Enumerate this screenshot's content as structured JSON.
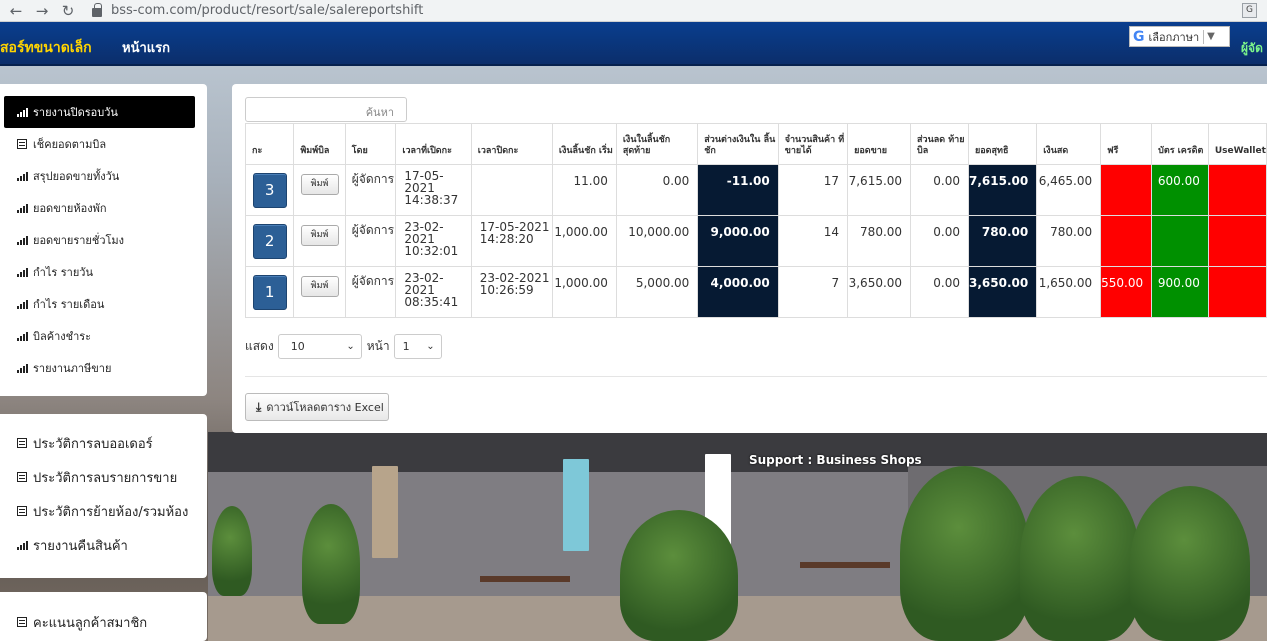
{
  "browser": {
    "url": "bss-com.com/product/resort/sale/salereportshift"
  },
  "navbar": {
    "brand": "สอร์ทขนาดเล็ก",
    "home": "หน้าแรก",
    "language_select": "เลือกภาษา",
    "user": "ผู้จัด"
  },
  "sidebar": {
    "reports": [
      {
        "label": "รายงานปิดรอบวัน",
        "icon": "bar-chart-icon",
        "active": true
      },
      {
        "label": "เช็คยอดตามบิล",
        "icon": "list-icon"
      },
      {
        "label": "สรุปยอดขายทั้งวัน",
        "icon": "bar-chart-icon"
      },
      {
        "label": "ยอดขายห้องพัก",
        "icon": "bar-chart-icon"
      },
      {
        "label": "ยอดขายรายชั่วโมง",
        "icon": "bar-chart-icon"
      },
      {
        "label": "กำไร รายวัน",
        "icon": "bar-chart-icon"
      },
      {
        "label": "กำไร รายเดือน",
        "icon": "bar-chart-icon"
      },
      {
        "label": "บิลค้างชำระ",
        "icon": "bar-chart-icon"
      },
      {
        "label": "รายงานภาษีขาย",
        "icon": "bar-chart-icon"
      }
    ],
    "history": [
      {
        "label": "ประวัติการลบออเดอร์",
        "icon": "list-icon"
      },
      {
        "label": "ประวัติการลบรายการขาย",
        "icon": "list-icon"
      },
      {
        "label": "ประวัติการย้ายห้อง/รวมห้อง",
        "icon": "list-icon"
      },
      {
        "label": "รายงานคืนสินค้า",
        "icon": "bar-chart-icon"
      }
    ],
    "members": [
      {
        "label": "คะแนนลูกค้าสมาชิก",
        "icon": "list-icon"
      }
    ]
  },
  "search": {
    "placeholder": "ค้นหา"
  },
  "table": {
    "headers": [
      "กะ",
      "พิมพ์บิล",
      "โดย",
      "เวลาที่เปิดกะ",
      "เวลาปิดกะ",
      "เงินลิ้นชัก เริ่ม",
      "เงินในลิ้นชัก สุดท้าย",
      "ส่วนต่างเงินใน ลิ้นชัก",
      "จำนวนสินค้า ที่ขายได้",
      "ยอดขาย",
      "ส่วนลด ท้ายบิล",
      "ยอดสุทธิ",
      "เงินสด",
      "ฟรี",
      "บัตร เครดิต",
      "UseWallet"
    ],
    "rows": [
      {
        "shift": "3",
        "print": "พิมพ์",
        "by": "ผู้จัดการ",
        "open": "17-05-2021 14:38:37",
        "close": "",
        "start_cash": "11.00",
        "end_cash": "0.00",
        "diff": "-11.00",
        "qty": "17",
        "sales": "7,615.00",
        "discount": "0.00",
        "net": "7,615.00",
        "cash": "6,465.00",
        "free": "",
        "credit": "600.00",
        "wallet": ""
      },
      {
        "shift": "2",
        "print": "พิมพ์",
        "by": "ผู้จัดการ",
        "open": "23-02-2021 10:32:01",
        "close": "17-05-2021 14:28:20",
        "start_cash": "1,000.00",
        "end_cash": "10,000.00",
        "diff": "9,000.00",
        "qty": "14",
        "sales": "780.00",
        "discount": "0.00",
        "net": "780.00",
        "cash": "780.00",
        "free": "",
        "credit": "",
        "wallet": ""
      },
      {
        "shift": "1",
        "print": "พิมพ์",
        "by": "ผู้จัดการ",
        "open": "23-02-2021 08:35:41",
        "close": "23-02-2021 10:26:59",
        "start_cash": "1,000.00",
        "end_cash": "5,000.00",
        "diff": "4,000.00",
        "qty": "7",
        "sales": "3,650.00",
        "discount": "0.00",
        "net": "3,650.00",
        "cash": "1,650.00",
        "free": "550.00",
        "credit": "900.00",
        "wallet": ""
      }
    ]
  },
  "pager": {
    "show_label": "แสดง",
    "page_size": "10",
    "page_label": "หน้า",
    "page": "1"
  },
  "export": {
    "label": "ดาวน์โหลดตาราง Excel"
  },
  "footer": {
    "support": "Support : Business Shops"
  },
  "colors": {
    "navbar": "#0a3e8e",
    "brand": "#ffd400",
    "dark_cell": "#061a33",
    "red_cell": "#ff0000",
    "green_cell": "#009000",
    "shift_button": "#2c5f96"
  }
}
